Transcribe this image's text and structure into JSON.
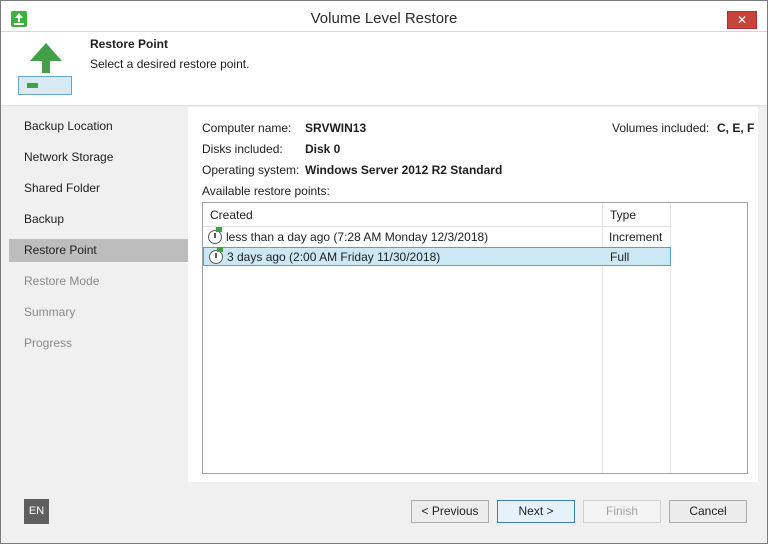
{
  "window": {
    "title": "Volume Level Restore",
    "close_glyph": "✕"
  },
  "header": {
    "title": "Restore Point",
    "subtitle": "Select a desired restore point."
  },
  "sidebar": {
    "items": [
      {
        "label": "Backup Location",
        "state": "normal"
      },
      {
        "label": "Network Storage",
        "state": "normal"
      },
      {
        "label": "Shared Folder",
        "state": "normal"
      },
      {
        "label": "Backup",
        "state": "normal"
      },
      {
        "label": "Restore Point",
        "state": "active"
      },
      {
        "label": "Restore Mode",
        "state": "disabled"
      },
      {
        "label": "Summary",
        "state": "disabled"
      },
      {
        "label": "Progress",
        "state": "disabled"
      }
    ]
  },
  "info": {
    "computer_name_label": "Computer name:",
    "computer_name": "SRVWIN13",
    "disks_label": "Disks included:",
    "disks": "Disk 0",
    "os_label": "Operating system:",
    "os": "Windows Server 2012 R2 Standard",
    "volumes_label": "Volumes included:",
    "volumes": "C, E, F",
    "list_label": "Available restore points:"
  },
  "restore_points": {
    "columns": [
      "Created",
      "Type"
    ],
    "rows": [
      {
        "created": "less than a day ago (7:28 AM Monday 12/3/2018)",
        "type": "Increment",
        "selected": false
      },
      {
        "created": "3 days ago (2:00 AM Friday 11/30/2018)",
        "type": "Full",
        "selected": true
      }
    ]
  },
  "footer": {
    "language": "EN",
    "previous": "< Previous",
    "next": "Next >",
    "finish": "Finish",
    "cancel": "Cancel"
  },
  "colors": {
    "accent_green": "#43a047",
    "selection": "#cde8f5",
    "close_red": "#c7433b"
  }
}
